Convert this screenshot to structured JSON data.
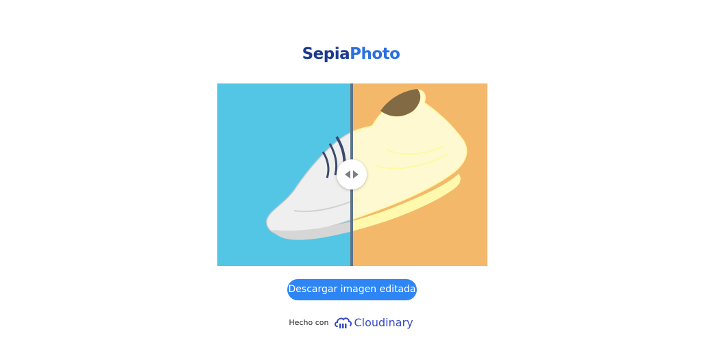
{
  "brand": {
    "part1": "Sepia",
    "part2": "Photo",
    "color_dark": "#1b3a8f",
    "color_light": "#2b6fe0"
  },
  "comparison": {
    "left_background": "#53c6e6",
    "right_background": "#f4b86a",
    "divider_color": "#5f7487",
    "handle_icon": "left-right-arrows-icon"
  },
  "actions": {
    "download_label": "Descargar imagen editada",
    "download_color": "#2e86f6"
  },
  "footer": {
    "made_with": "Hecho con",
    "provider": "Cloudinary",
    "provider_icon": "cloudinary-logo-icon",
    "provider_color": "#3448c5"
  }
}
